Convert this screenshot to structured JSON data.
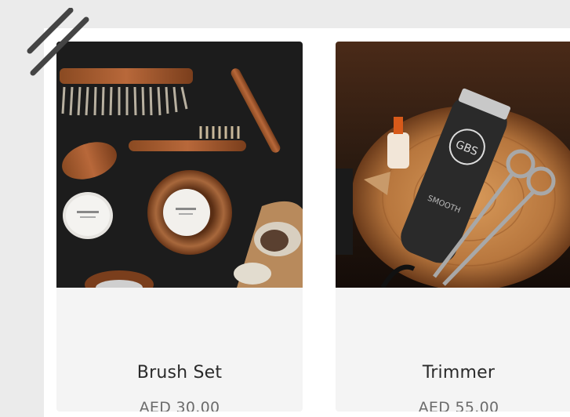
{
  "products": [
    {
      "name": "Brush Set",
      "price": "AED 30.00",
      "image": "brush-set-photo"
    },
    {
      "name": "Trimmer",
      "price": "AED 55.00",
      "image": "trimmer-photo"
    }
  ],
  "colors": {
    "page_background": "#ebebeb",
    "card_background": "#f4f4f4",
    "name_text": "#2a2a2a",
    "price_text": "#6b6b6b",
    "stripe": "#444444"
  }
}
